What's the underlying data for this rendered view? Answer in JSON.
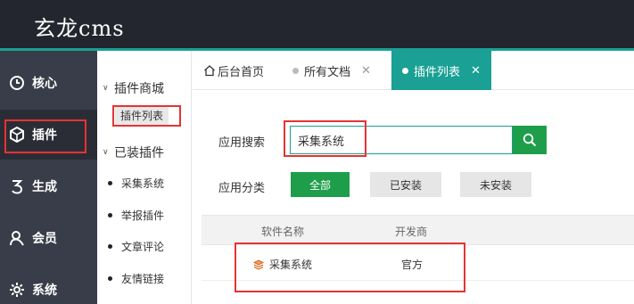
{
  "header": {
    "logo": "玄龙cms"
  },
  "nav": {
    "items": [
      {
        "label": "核心",
        "icon": "clock-icon"
      },
      {
        "label": "插件",
        "icon": "cube-icon"
      },
      {
        "label": "生成",
        "icon": "number-3-icon"
      },
      {
        "label": "会员",
        "icon": "user-icon"
      },
      {
        "label": "系统",
        "icon": "gear-icon"
      }
    ],
    "active_index": 1
  },
  "subnav": {
    "groups": [
      {
        "title": "插件商城",
        "items": [
          "插件列表"
        ]
      },
      {
        "title": "已装插件",
        "items": [
          "采集系统",
          "举报插件",
          "文章评论",
          "友情链接"
        ]
      }
    ]
  },
  "tabs": [
    {
      "label": "后台首页",
      "icon": "home-icon"
    },
    {
      "label": "所有文档"
    },
    {
      "label": "插件列表",
      "active": true
    }
  ],
  "main": {
    "search_label": "应用搜索",
    "search_value": "采集系统",
    "category_label": "应用分类",
    "categories": [
      "全部",
      "已安装",
      "未安装"
    ],
    "table": {
      "headers": [
        "软件名称",
        "开发商"
      ],
      "rows": [
        {
          "name": "采集系统",
          "developer": "官方"
        }
      ]
    }
  },
  "colors": {
    "header_bg": "#23262e",
    "accent": "#1aa094",
    "primary_button": "#1e9e4a",
    "highlight": "#e53333"
  }
}
